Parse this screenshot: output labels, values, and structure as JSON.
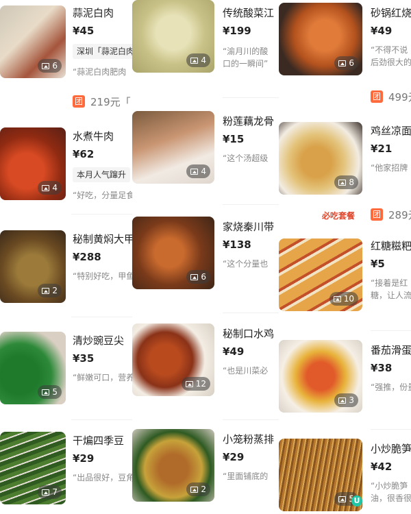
{
  "columns": [
    {
      "items": [
        {
          "name": "蒜泥白肉",
          "price": "¥45",
          "tag": "深圳「蒜泥白肉",
          "quote": "“蒜泥白肉肥肉",
          "photos": "6",
          "img": "#e8dcc8"
        },
        {
          "name": "水煮牛肉",
          "price": "¥62",
          "tag": "本月人气蹿升",
          "quote": "“好吃，分量足食",
          "photos": "4",
          "img": "#c8391e"
        },
        {
          "name": "秘制黄焖大甲",
          "price": "¥288",
          "tag": "",
          "quote": "“特别好吃，甲鱼",
          "photos": "2",
          "img": "#7a5a2b"
        },
        {
          "name": "清炒豌豆尖",
          "price": "¥35",
          "tag": "",
          "quote": "“鲜嫩可口，营养",
          "photos": "5",
          "img": "#2e8a3a"
        },
        {
          "name": "干煸四季豆",
          "price": "¥29",
          "tag": "",
          "quote": "“出品很好，豆角",
          "photos": "7",
          "img": "#3d6b2a"
        }
      ],
      "deal": {
        "badge": "团",
        "text": "219元「"
      }
    },
    {
      "items": [
        {
          "name": "传统酸菜江",
          "price": "¥199",
          "tag": "",
          "quote": "“渝月川的酸",
          "quote2": "口的一瞬间”",
          "photos": "4",
          "img": "#d7cf9a"
        },
        {
          "name": "粉莲藕龙骨",
          "price": "¥15",
          "tag": "",
          "quote": "“这个汤超级",
          "photos": "4",
          "img": "#c99572"
        },
        {
          "name": "家烧秦川带",
          "price": "¥138",
          "tag": "",
          "quote": "“这个分量也",
          "photos": "6",
          "img": "#b65a28"
        },
        {
          "name": "秘制口水鸡",
          "price": "¥49",
          "tag": "",
          "quote": "“也是川菜必",
          "photos": "12",
          "img": "#a83b1c"
        },
        {
          "name": "小笼粉蒸排",
          "price": "¥29",
          "tag": "",
          "quote": "“里面铺底的",
          "photos": "2",
          "img": "#c7a23a"
        }
      ]
    },
    {
      "items": [
        {
          "name": "砂锅红烧",
          "price": "¥49",
          "tag": "",
          "quote": "“不得不说",
          "quote2": "后劲很大的",
          "photos": "6",
          "img": "#d66a2c"
        },
        {
          "name": "鸡丝凉面",
          "price": "¥21",
          "tag": "",
          "quote": "“他家招牌",
          "photos": "8",
          "img": "#e3c37a"
        },
        {
          "name": "红糖糍粑",
          "price": "¥5",
          "tag": "",
          "quote": "“接着是红",
          "quote2": "糖，让人流",
          "photos": "10",
          "img": "#e7a54a"
        },
        {
          "name": "番茄滑蛋",
          "price": "¥38",
          "tag": "",
          "quote": "“强推，份量",
          "photos": "3",
          "img": "#e15a2a"
        },
        {
          "name": "小炒脆笋",
          "price": "¥42",
          "tag": "",
          "quote": "“小炒脆笋",
          "quote2": "油，很香很",
          "photos": "5",
          "img": "#b8782c"
        }
      ],
      "deals": [
        {
          "badge": "团",
          "text": "499元"
        },
        {
          "badge": "团",
          "text": "289元"
        }
      ],
      "must_eat": "必吃套餐",
      "u_badge": "U"
    }
  ]
}
